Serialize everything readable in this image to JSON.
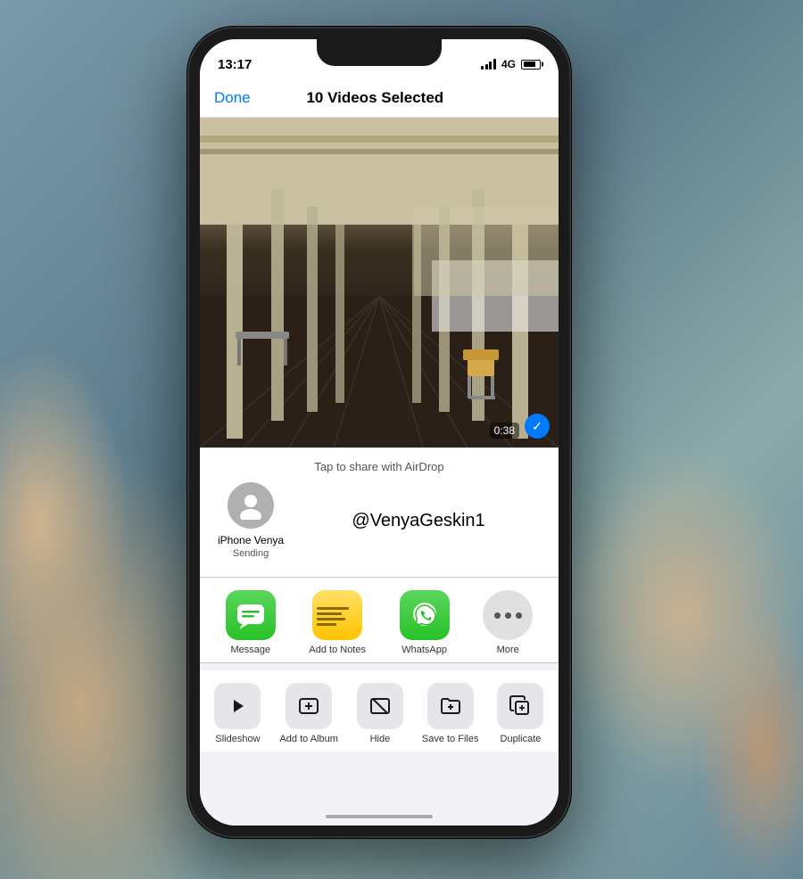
{
  "scene": {
    "background": "#6a8a9a"
  },
  "statusBar": {
    "time": "13:17",
    "signal": "4G",
    "battery": "80"
  },
  "navBar": {
    "doneLabel": "Done",
    "title": "10 Videos Selected"
  },
  "videoPreview": {
    "duration": "0:38",
    "selectedBadge": "✓"
  },
  "shareSheet": {
    "airdropHint": "Tap to share with AirDrop",
    "deviceName": "iPhone Venya",
    "deviceStatus": "Sending",
    "username": "@VenyaGeskin1"
  },
  "apps": [
    {
      "id": "message",
      "label": "Message",
      "icon": "message"
    },
    {
      "id": "notes",
      "label": "Add to Notes",
      "icon": "notes"
    },
    {
      "id": "whatsapp",
      "label": "WhatsApp",
      "icon": "whatsapp"
    },
    {
      "id": "more",
      "label": "More",
      "icon": "more"
    }
  ],
  "actions": [
    {
      "id": "slideshow",
      "label": "Slideshow",
      "icon": "▶"
    },
    {
      "id": "add-album",
      "label": "Add to Album",
      "icon": "➕"
    },
    {
      "id": "hide",
      "label": "Hide",
      "icon": "🚫"
    },
    {
      "id": "save-files",
      "label": "Save to Files",
      "icon": "📁"
    },
    {
      "id": "duplicate",
      "label": "Duplicate",
      "icon": "📋"
    }
  ],
  "icons": {
    "check": "✓",
    "person": "👤",
    "play": "▶",
    "addAlbum": "⊞",
    "hide": "⊘",
    "saveFiles": "🗂",
    "duplicate": "⊕"
  }
}
